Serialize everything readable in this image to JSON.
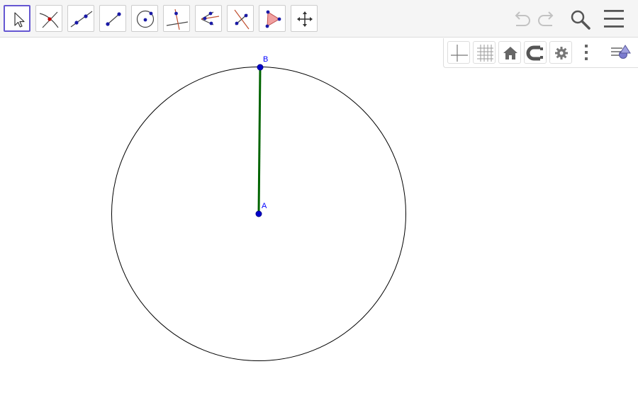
{
  "toolbar": {
    "tools": [
      {
        "name": "move-tool",
        "selected": true
      },
      {
        "name": "intersect-tool"
      },
      {
        "name": "line-tool"
      },
      {
        "name": "segment-tool"
      },
      {
        "name": "circle-center-point-tool"
      },
      {
        "name": "perpendicular-line-tool"
      },
      {
        "name": "angle-bisector-tool"
      },
      {
        "name": "perpendicular-bisector-tool"
      },
      {
        "name": "polygon-tool"
      },
      {
        "name": "move-graphics-view-tool"
      }
    ],
    "actions": {
      "undo_icon": "undo-icon",
      "redo_icon": "redo-icon",
      "search_icon": "search-icon",
      "menu_icon": "menu-icon"
    }
  },
  "style_bar": {
    "buttons": [
      "axes-icon",
      "grid-icon",
      "home-icon",
      "point-capturing-icon",
      "gear-icon",
      "more-icon",
      "toggle-style-bar-icon"
    ]
  },
  "construction": {
    "points": [
      {
        "label": "A"
      },
      {
        "label": "B"
      }
    ],
    "segment_color": "#006400",
    "circle_color": "#000000",
    "point_color": "#0000cc"
  },
  "colors": {
    "accent": "#6557d2",
    "label": "#0000ff"
  }
}
